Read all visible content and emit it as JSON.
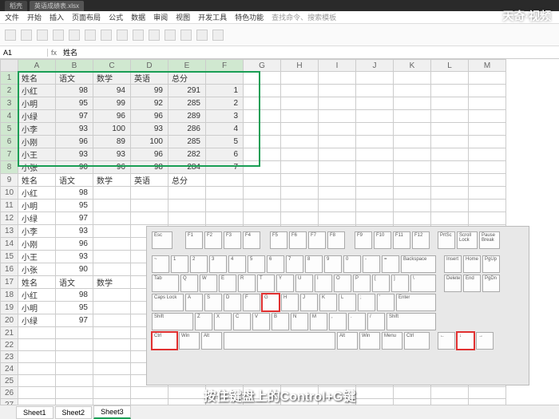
{
  "title": {
    "tab1": "稻壳",
    "tab2": "英语成绩表.xlsx"
  },
  "menu": {
    "file": "文件",
    "start": "开始",
    "insert": "插入",
    "layout": "页面布局",
    "formula": "公式",
    "data": "数据",
    "review": "审阅",
    "view": "视图",
    "dev": "开发工具",
    "special": "特色功能",
    "search": "查找命令、搜索模板"
  },
  "formula_bar": {
    "name_box": "A1",
    "fx": "fx",
    "value": "姓名"
  },
  "cols": [
    "A",
    "B",
    "C",
    "D",
    "E",
    "F",
    "G",
    "H",
    "I",
    "J",
    "K",
    "L",
    "M"
  ],
  "headers": {
    "name": "姓名",
    "chinese": "语文",
    "math": "数学",
    "english": "英语",
    "total": "总分"
  },
  "data_rows": [
    {
      "name": "小红",
      "c": 98,
      "m": 94,
      "e": 99,
      "t": 291,
      "idx": 1
    },
    {
      "name": "小明",
      "c": 95,
      "m": 99,
      "e": 92,
      "t": 285,
      "idx": 2
    },
    {
      "name": "小绿",
      "c": 97,
      "m": 96,
      "e": 96,
      "t": 289,
      "idx": 3
    },
    {
      "name": "小李",
      "c": 93,
      "m": 100,
      "e": 93,
      "t": 286,
      "idx": 4
    },
    {
      "name": "小刚",
      "c": 96,
      "m": 89,
      "e": 100,
      "t": 285,
      "idx": 5
    },
    {
      "name": "小王",
      "c": 93,
      "m": 93,
      "e": 96,
      "t": 282,
      "idx": 6
    },
    {
      "name": "小张",
      "c": 90,
      "m": 96,
      "e": 98,
      "t": 284,
      "idx": 7
    }
  ],
  "lower_rows": [
    {
      "r": 10,
      "name": "小红",
      "c": 98
    },
    {
      "r": 11,
      "name": "小明",
      "c": 95
    },
    {
      "r": 12,
      "name": "小绿",
      "c": 97
    },
    {
      "r": 13,
      "name": "小李",
      "c": 93
    },
    {
      "r": 14,
      "name": "小刚",
      "c": 96
    },
    {
      "r": 15,
      "name": "小王",
      "c": 93
    },
    {
      "r": 16,
      "name": "小张",
      "c": 90
    }
  ],
  "second_block": [
    {
      "r": 18,
      "name": "小红",
      "c": 98
    },
    {
      "r": 19,
      "name": "小明",
      "c": 95
    },
    {
      "r": 20,
      "name": "小绿",
      "c": 97
    }
  ],
  "row9": {
    "name": "姓名",
    "chinese": "语文",
    "math": "数学",
    "english": "英语",
    "total": "总分"
  },
  "row17": {
    "name": "姓名",
    "chinese": "语文",
    "math": "数学"
  },
  "keyboard": {
    "esc": "Esc",
    "f1": "F1",
    "f2": "F2",
    "f3": "F3",
    "f4": "F4",
    "f5": "F5",
    "f6": "F6",
    "f7": "F7",
    "f8": "F8",
    "f9": "F9",
    "f10": "F10",
    "f11": "F11",
    "f12": "F12",
    "tilde": "~",
    "n1": "1",
    "n2": "2",
    "n3": "3",
    "n4": "4",
    "n5": "5",
    "n6": "6",
    "n7": "7",
    "n8": "8",
    "n9": "9",
    "n0": "0",
    "minus": "-",
    "eq": "=",
    "back": "Backspace",
    "tab": "Tab",
    "q": "Q",
    "w": "W",
    "e": "E",
    "r": "R",
    "t": "T",
    "y": "Y",
    "u": "U",
    "i": "I",
    "o": "O",
    "p": "P",
    "lb": "[",
    "rb": "]",
    "bs": "\\",
    "caps": "Caps Lock",
    "a": "A",
    "s": "S",
    "d": "D",
    "f": "F",
    "g": "G",
    "h": "H",
    "j": "J",
    "k": "K",
    "l": "L",
    "sc": ";",
    "qt": "'",
    "enter": "Enter",
    "lshift": "Shift",
    "z": "Z",
    "x": "X",
    "c": "C",
    "v": "V",
    "b": "B",
    "n": "N",
    "m": "M",
    "cm": ",",
    "pd": ".",
    "sl": "/",
    "rshift": "Shift",
    "lctrl": "Ctrl",
    "lwin": "Win",
    "lalt": "Alt",
    "space": "",
    "ralt": "Alt",
    "rwin": "Win",
    "menu": "Menu",
    "rctrl": "Ctrl",
    "prtsc": "PrtSc",
    "scrlk": "Scroll Lock",
    "pause": "Pause Break",
    "ins": "Insert",
    "home": "Home",
    "pgup": "PgUp",
    "del": "Delete",
    "end": "End",
    "pgdn": "PgDn"
  },
  "sheets": {
    "s1": "Sheet1",
    "s2": "Sheet2",
    "s3": "Sheet3"
  },
  "watermark": "天奇·视频",
  "subtitle": "按住键盘上的Control+G键"
}
